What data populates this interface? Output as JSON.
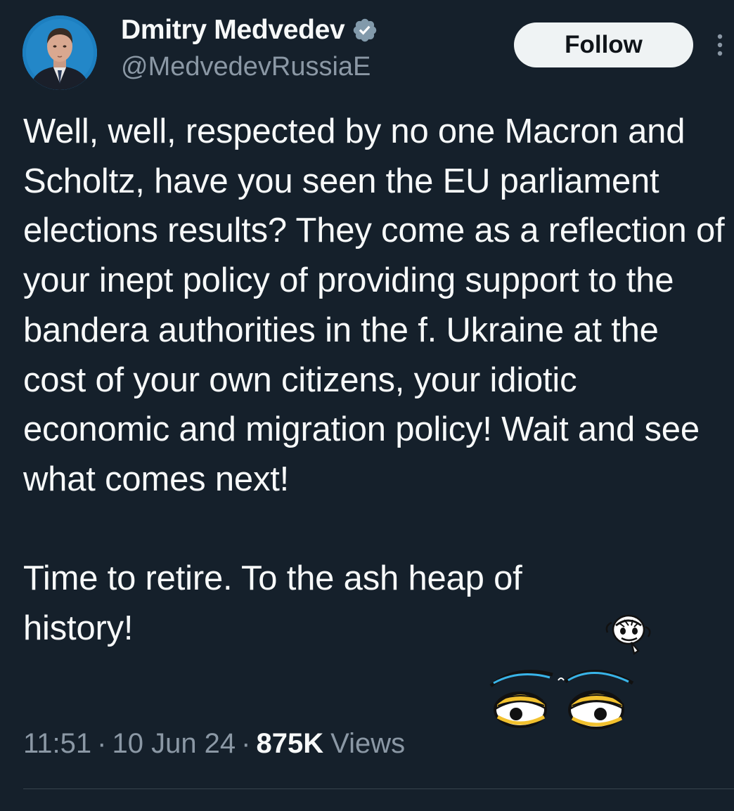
{
  "author": {
    "display_name": "Dmitry Medvedev",
    "handle": "@MedvedevRussiaE",
    "verified": true,
    "avatar_icon": "profile-photo"
  },
  "actions": {
    "follow_label": "Follow",
    "more_icon": "more-vertical-icon"
  },
  "tweet": {
    "text_paragraph_1": "Well, well, respected by no one Macron and Scholtz, have you seen the EU parliament elections results? They come as a reflection of your inept policy of providing support to the bandera authorities in the f. Ukraine at the cost of your own citizens, your idiotic economic and migration policy! Wait and see what comes next!",
    "text_paragraph_2": "Time to retire. To the ash heap of\nhistory!",
    "emoji_1": "monkey-thinking-emoji",
    "emoji_2": "eyes-emoji"
  },
  "meta": {
    "time": "11:51",
    "separator": "·",
    "date": "10 Jun 24",
    "views_count": "875K",
    "views_label": "Views"
  },
  "colors": {
    "background": "#15202b",
    "text_primary": "#f7f9f9",
    "text_secondary": "#8b98a5",
    "verified_badge": "#829aab",
    "follow_bg": "#eff3f4",
    "divider": "#38444d"
  }
}
